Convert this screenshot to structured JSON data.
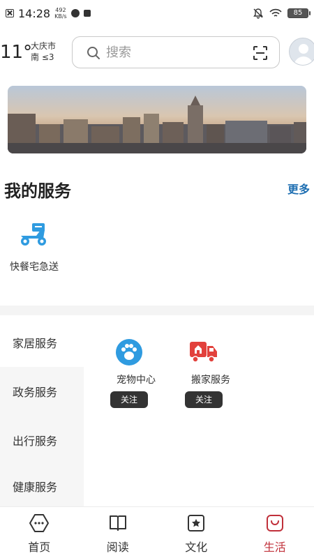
{
  "status_bar": {
    "time": "14:28",
    "speed_value": "492",
    "speed_unit": "KB/s",
    "battery": "85"
  },
  "weather": {
    "temperature": "11°",
    "city": "大庆市",
    "wind": "南 ≤3"
  },
  "search": {
    "placeholder": "搜索"
  },
  "my_services": {
    "title": "我的服务",
    "more_label": "更多",
    "items": [
      {
        "label": "快餐宅急送",
        "icon": "scooter-icon",
        "color": "#2f9be0"
      }
    ]
  },
  "categories": [
    {
      "label": "家居服务",
      "active": true
    },
    {
      "label": "政务服务",
      "active": false
    },
    {
      "label": "出行服务",
      "active": false
    },
    {
      "label": "健康服务",
      "active": false
    }
  ],
  "category_items": [
    {
      "label": "宠物中心",
      "follow_label": "关注",
      "icon": "paw-icon",
      "color": "#2f9be0"
    },
    {
      "label": "搬家服务",
      "follow_label": "关注",
      "icon": "truck-icon",
      "color": "#e2413c"
    }
  ],
  "bottom_nav": [
    {
      "label": "首页",
      "icon": "home-icon",
      "active": false
    },
    {
      "label": "阅读",
      "icon": "book-icon",
      "active": false
    },
    {
      "label": "文化",
      "icon": "culture-icon",
      "active": false
    },
    {
      "label": "生活",
      "icon": "life-icon",
      "active": true
    }
  ],
  "colors": {
    "accent_blue": "#1f6fb2",
    "active_red": "#c0303a"
  }
}
